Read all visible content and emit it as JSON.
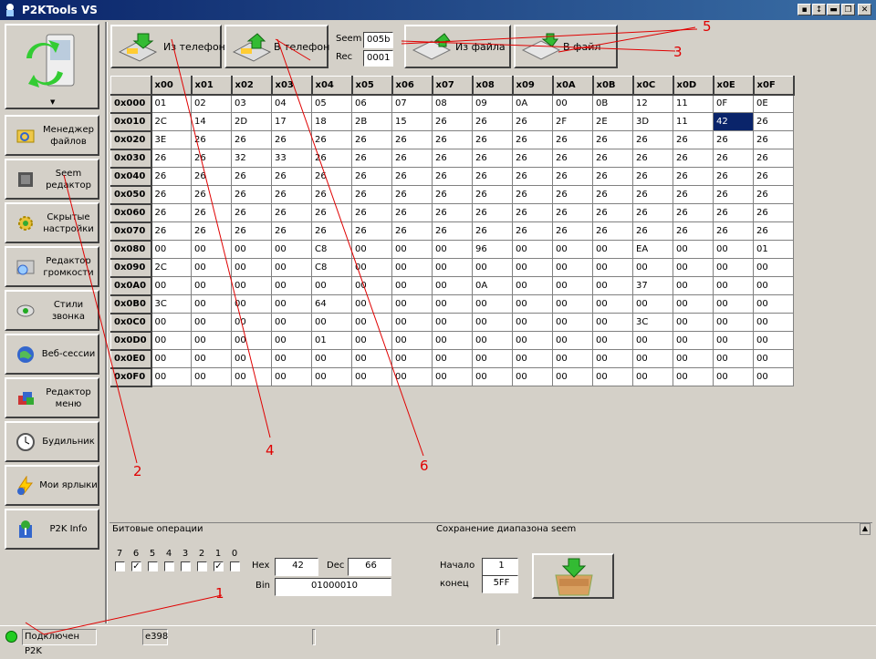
{
  "window": {
    "title": "P2KTools VS",
    "controls": [
      "▪",
      "↕",
      "▬",
      "❐",
      "✕"
    ]
  },
  "sidebar": {
    "items": [
      {
        "label": "Менеджер файлов",
        "icon": "file-manager-icon"
      },
      {
        "label": "Seem редактор",
        "icon": "seem-editor-icon"
      },
      {
        "label": "Скрытые настройки",
        "icon": "hidden-settings-icon"
      },
      {
        "label": "Редактор громкости",
        "icon": "volume-editor-icon"
      },
      {
        "label": "Стили звонка",
        "icon": "ring-styles-icon"
      },
      {
        "label": "Веб-сессии",
        "icon": "web-sessions-icon"
      },
      {
        "label": "Редактор меню",
        "icon": "menu-editor-icon"
      },
      {
        "label": "Будильник",
        "icon": "alarm-clock-icon"
      },
      {
        "label": "Мои ярлыки",
        "icon": "shortcuts-icon"
      },
      {
        "label": "P2K Info",
        "icon": "p2k-info-icon"
      }
    ]
  },
  "toolbar": {
    "from_phone": "Из телефона",
    "to_phone": "В телефон",
    "seem_label": "Seem",
    "seem_value": "005b",
    "rec_label": "Rec",
    "rec_value": "0001",
    "from_file": "Из файла",
    "to_file": "В файл"
  },
  "grid": {
    "columns": [
      "x00",
      "x01",
      "x02",
      "x03",
      "x04",
      "x05",
      "x06",
      "x07",
      "x08",
      "x09",
      "x0A",
      "x0B",
      "x0C",
      "x0D",
      "x0E",
      "x0F"
    ],
    "rows": [
      {
        "addr": "0x000",
        "cells": [
          "01",
          "02",
          "03",
          "04",
          "05",
          "06",
          "07",
          "08",
          "09",
          "0A",
          "00",
          "0B",
          "12",
          "11",
          "0F",
          "0E"
        ]
      },
      {
        "addr": "0x010",
        "cells": [
          "2C",
          "14",
          "2D",
          "17",
          "18",
          "2B",
          "15",
          "26",
          "26",
          "26",
          "2F",
          "2E",
          "3D",
          "11",
          "42",
          "26"
        ]
      },
      {
        "addr": "0x020",
        "cells": [
          "3E",
          "26",
          "26",
          "26",
          "26",
          "26",
          "26",
          "26",
          "26",
          "26",
          "26",
          "26",
          "26",
          "26",
          "26",
          "26"
        ]
      },
      {
        "addr": "0x030",
        "cells": [
          "26",
          "26",
          "32",
          "33",
          "26",
          "26",
          "26",
          "26",
          "26",
          "26",
          "26",
          "26",
          "26",
          "26",
          "26",
          "26"
        ]
      },
      {
        "addr": "0x040",
        "cells": [
          "26",
          "26",
          "26",
          "26",
          "26",
          "26",
          "26",
          "26",
          "26",
          "26",
          "26",
          "26",
          "26",
          "26",
          "26",
          "26"
        ]
      },
      {
        "addr": "0x050",
        "cells": [
          "26",
          "26",
          "26",
          "26",
          "26",
          "26",
          "26",
          "26",
          "26",
          "26",
          "26",
          "26",
          "26",
          "26",
          "26",
          "26"
        ]
      },
      {
        "addr": "0x060",
        "cells": [
          "26",
          "26",
          "26",
          "26",
          "26",
          "26",
          "26",
          "26",
          "26",
          "26",
          "26",
          "26",
          "26",
          "26",
          "26",
          "26"
        ]
      },
      {
        "addr": "0x070",
        "cells": [
          "26",
          "26",
          "26",
          "26",
          "26",
          "26",
          "26",
          "26",
          "26",
          "26",
          "26",
          "26",
          "26",
          "26",
          "26",
          "26"
        ]
      },
      {
        "addr": "0x080",
        "cells": [
          "00",
          "00",
          "00",
          "00",
          "C8",
          "00",
          "00",
          "00",
          "96",
          "00",
          "00",
          "00",
          "EA",
          "00",
          "00",
          "01"
        ]
      },
      {
        "addr": "0x090",
        "cells": [
          "2C",
          "00",
          "00",
          "00",
          "C8",
          "00",
          "00",
          "00",
          "00",
          "00",
          "00",
          "00",
          "00",
          "00",
          "00",
          "00"
        ]
      },
      {
        "addr": "0x0A0",
        "cells": [
          "00",
          "00",
          "00",
          "00",
          "00",
          "00",
          "00",
          "00",
          "0A",
          "00",
          "00",
          "00",
          "37",
          "00",
          "00",
          "00"
        ]
      },
      {
        "addr": "0x0B0",
        "cells": [
          "3C",
          "00",
          "00",
          "00",
          "64",
          "00",
          "00",
          "00",
          "00",
          "00",
          "00",
          "00",
          "00",
          "00",
          "00",
          "00"
        ]
      },
      {
        "addr": "0x0C0",
        "cells": [
          "00",
          "00",
          "00",
          "00",
          "00",
          "00",
          "00",
          "00",
          "00",
          "00",
          "00",
          "00",
          "3C",
          "00",
          "00",
          "00"
        ]
      },
      {
        "addr": "0x0D0",
        "cells": [
          "00",
          "00",
          "00",
          "00",
          "01",
          "00",
          "00",
          "00",
          "00",
          "00",
          "00",
          "00",
          "00",
          "00",
          "00",
          "00"
        ]
      },
      {
        "addr": "0x0E0",
        "cells": [
          "00",
          "00",
          "00",
          "00",
          "00",
          "00",
          "00",
          "00",
          "00",
          "00",
          "00",
          "00",
          "00",
          "00",
          "00",
          "00"
        ]
      },
      {
        "addr": "0x0F0",
        "cells": [
          "00",
          "00",
          "00",
          "00",
          "00",
          "00",
          "00",
          "00",
          "00",
          "00",
          "00",
          "00",
          "00",
          "00",
          "00",
          "00"
        ]
      }
    ],
    "selected": {
      "row": 1,
      "col": 14
    }
  },
  "bit_ops": {
    "title": "Битовые операции",
    "bits": [
      "7",
      "6",
      "5",
      "4",
      "3",
      "2",
      "1",
      "0"
    ],
    "checked": [
      false,
      true,
      false,
      false,
      false,
      false,
      true,
      false
    ],
    "hex_label": "Hex",
    "hex_value": "42",
    "dec_label": "Dec",
    "dec_value": "66",
    "bin_label": "Bin",
    "bin_value": "01000010"
  },
  "seem_range": {
    "title": "Сохранение диапазона seem",
    "start_label": "Начало",
    "start_value": "1",
    "end_label": "конец",
    "end_value": "5FF"
  },
  "status": {
    "connection": "Подключен P2K",
    "code": "e398"
  },
  "annotations": [
    "1",
    "2",
    "3",
    "4",
    "5",
    "6"
  ],
  "colors": {
    "title_start": "#0a246a",
    "title_end": "#3a6ea5",
    "face": "#d4d0c8",
    "selected": "#0a246a",
    "annotation": "#e00000",
    "connected": "#22cc22"
  }
}
